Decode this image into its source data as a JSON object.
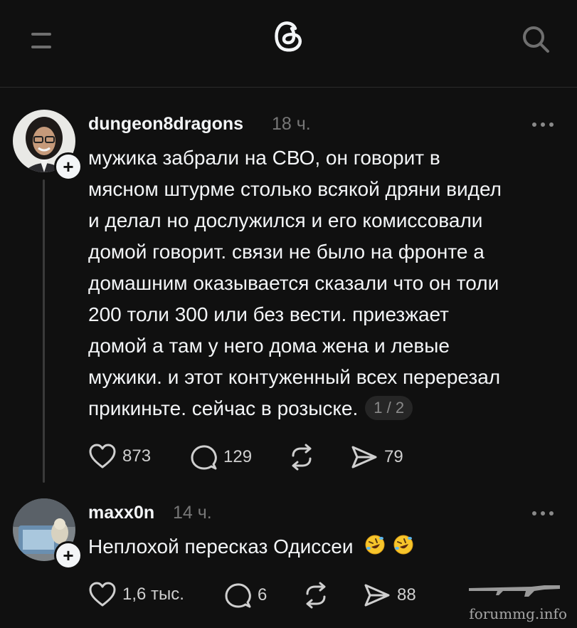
{
  "header": {
    "menu_icon": "hamburger-menu-icon",
    "logo_icon": "threads-logo-icon",
    "search_icon": "search-icon"
  },
  "posts": [
    {
      "username": "dungeon8dragons",
      "time": "18 ч.",
      "lines": [
        "мужика забрали на СВО, он говорит в",
        "мясном штурме столько всякой дряни видел",
        "и делал но дослужился и его комиссовали",
        "домой говорит. связи не было на фронте а",
        "домашним оказывается сказали что он толи",
        "200 толи 300 или без вести. приезжает",
        "домой а там у него дома жена и левые",
        "мужики. и этот контуженный всех перерезал",
        "прикиньте. сейчас в розыске."
      ],
      "page_indicator": "1 / 2",
      "actions": {
        "likes": "873",
        "replies": "129",
        "reposts": "",
        "shares": "79"
      }
    },
    {
      "username": "maxx0n",
      "time": "14 ч.",
      "lines": [
        "Неплохой пересказ Одиссеи"
      ],
      "emoji": [
        "rolling-on-floor-laughing",
        "rolling-on-floor-laughing"
      ],
      "actions": {
        "likes": "1,6 тыс.",
        "replies": "6",
        "reposts": "",
        "shares": "88"
      }
    }
  ],
  "watermark": {
    "text": "forummg.info"
  },
  "colors": {
    "background": "#101010",
    "text_primary": "#f3f5f7",
    "text_secondary": "#777777"
  }
}
